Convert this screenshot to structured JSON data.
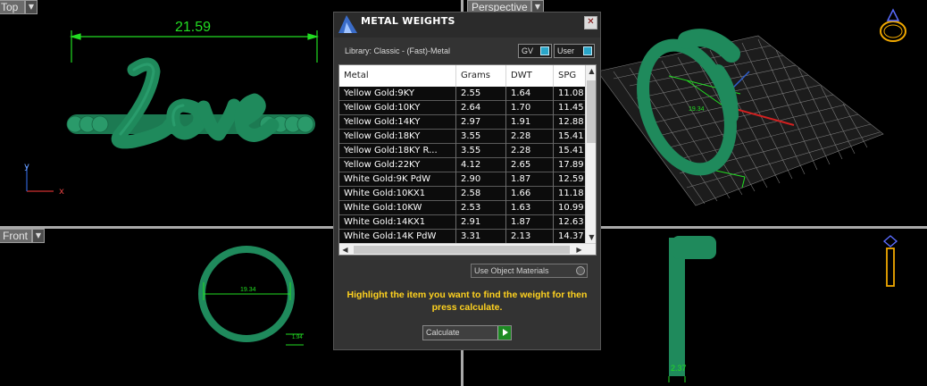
{
  "viewports": {
    "top": {
      "label": "Top",
      "dimension": "21.59"
    },
    "perspective": {
      "label": "Perspective",
      "dimension": "19.34"
    },
    "front": {
      "label": "Front",
      "dimension": "19.34",
      "dimension_small": "1.94"
    },
    "right": {
      "dimension": "2.37"
    },
    "top_text": "Love"
  },
  "colors": {
    "model": "#1f8a5c",
    "dimension": "#22dd22",
    "gold_icon": "#f0a800",
    "dialog_bg": "#333333",
    "hint": "#ffd21f"
  },
  "dialog": {
    "title": "METAL WEIGHTS",
    "close_label": "✕",
    "library_text": "Library: Classic - (Fast)-Metal",
    "toggle_gv": "GV",
    "toggle_user": "User",
    "columns": [
      "Metal",
      "Grams",
      "DWT",
      "SPG"
    ],
    "rows": [
      [
        "Yellow Gold:9KY",
        "2.55",
        "1.64",
        "11.08"
      ],
      [
        "Yellow Gold:10KY",
        "2.64",
        "1.70",
        "11.45"
      ],
      [
        "Yellow Gold:14KY",
        "2.97",
        "1.91",
        "12.88"
      ],
      [
        "Yellow Gold:18KY",
        "3.55",
        "2.28",
        "15.41"
      ],
      [
        "Yellow Gold:18KY R...",
        "3.55",
        "2.28",
        "15.41"
      ],
      [
        "Yellow Gold:22KY",
        "4.12",
        "2.65",
        "17.89"
      ],
      [
        "White Gold:9K PdW",
        "2.90",
        "1.87",
        "12.59"
      ],
      [
        "White Gold:10KX1",
        "2.58",
        "1.66",
        "11.18"
      ],
      [
        "White Gold:10KW",
        "2.53",
        "1.63",
        "10.99"
      ],
      [
        "White Gold:14KX1",
        "2.91",
        "1.87",
        "12.63"
      ],
      [
        "White Gold:14K PdW",
        "3.31",
        "2.13",
        "14.37"
      ]
    ],
    "use_object_materials": "Use Object Materials",
    "hint": "Highlight the item you want to find the weight for then press calculate.",
    "calculate_label": "Calculate"
  },
  "icons": {
    "ring_icon": "ring-icon",
    "ring_side_icon": "ring-side-icon",
    "logo": "metal-weights-logo-icon"
  }
}
